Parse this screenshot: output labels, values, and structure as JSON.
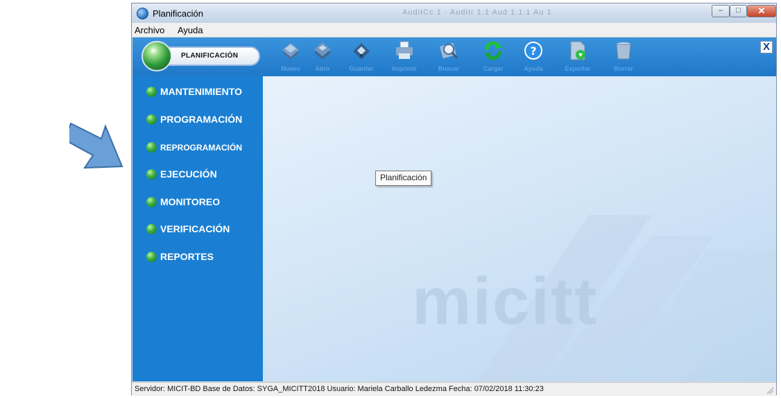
{
  "window": {
    "title": "Planificación",
    "ghost_tabs": "AuditCc   1 · Auditr 1.1 Aud   1.1.1 Au   1"
  },
  "menubar": {
    "archivo": "Archivo",
    "ayuda": "Ayuda"
  },
  "toolbar": {
    "module_label": "PLANIFICACIÓN",
    "buttons": [
      {
        "label": "Nuevo",
        "icon": "stack-new-icon"
      },
      {
        "label": "Abrir",
        "icon": "stack-open-icon"
      },
      {
        "label": "Guardar",
        "icon": "floppy-save-icon"
      },
      {
        "label": "Imprimir",
        "icon": "printer-icon"
      },
      {
        "label": "Buscar",
        "icon": "search-icon"
      },
      {
        "label": "Cargar",
        "icon": "refresh-icon"
      },
      {
        "label": "Ayuda",
        "icon": "help-icon"
      },
      {
        "label": "Exportar",
        "icon": "export-icon"
      },
      {
        "label": "Borrar",
        "icon": "trash-icon"
      }
    ],
    "close_glyph": "X"
  },
  "sidebar": {
    "items": [
      {
        "label": "MANTENIMIENTO"
      },
      {
        "label": "PROGRAMACIÓN"
      },
      {
        "label": "REPROGRAMACIÓN"
      },
      {
        "label": "EJECUCIÓN"
      },
      {
        "label": "MONITOREO"
      },
      {
        "label": "VERIFICACIÓN"
      },
      {
        "label": "REPORTES"
      }
    ]
  },
  "content": {
    "tooltip": "Planificación",
    "watermark": "micitt"
  },
  "statusbar": {
    "text": "Servidor: MICIT-BD  Base de Datos: SYGA_MICITT2018  Usuario: Mariela Carballo Ledezma  Fecha: 07/02/2018 11:30:23"
  },
  "colors": {
    "accent": "#1a7fd2",
    "toolbar": "#2a86d4",
    "nav_dot": "#44b545"
  }
}
